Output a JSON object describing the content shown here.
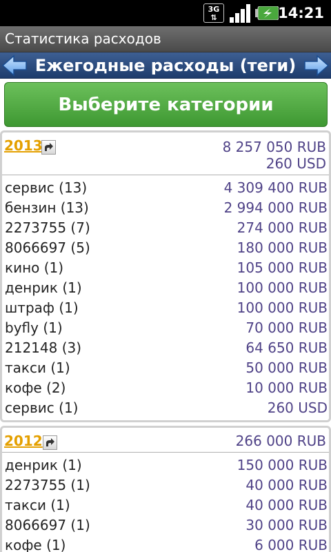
{
  "status_bar": {
    "network_label": "3G",
    "time": "14:21",
    "icons": [
      "3g-icon",
      "signal-icon",
      "battery-icon"
    ]
  },
  "app": {
    "title": "Статистика расходов"
  },
  "nav": {
    "title": "Ежегодные расходы (теги)",
    "prev_icon": "arrow-left-icon",
    "next_icon": "arrow-right-icon"
  },
  "category_button": {
    "label": "Выберите категории"
  },
  "colors": {
    "year_link": "#e4a000",
    "amount": "#4f4287",
    "button_green": "#4caf3f",
    "nav_blue": "#2a4b7e"
  },
  "sections": [
    {
      "year": "2013",
      "totals": [
        "8 257 050 RUB",
        "260 USD"
      ],
      "rows": [
        {
          "label": "сервис (13)",
          "value": "4 309 400 RUB"
        },
        {
          "label": "бензин (13)",
          "value": "2 994 000 RUB"
        },
        {
          "label": "2273755 (7)",
          "value": "274 000 RUB"
        },
        {
          "label": "8066697 (5)",
          "value": "180 000 RUB"
        },
        {
          "label": "кино (1)",
          "value": "105 000 RUB"
        },
        {
          "label": "денрик (1)",
          "value": "100 000 RUB"
        },
        {
          "label": "штраф (1)",
          "value": "100 000 RUB"
        },
        {
          "label": "byfly (1)",
          "value": "70 000 RUB"
        },
        {
          "label": "212148 (3)",
          "value": "64 650 RUB"
        },
        {
          "label": "такси (1)",
          "value": "50 000 RUB"
        },
        {
          "label": "кофе (2)",
          "value": "10 000 RUB"
        },
        {
          "label": "сервис (1)",
          "value": "260 USD"
        }
      ]
    },
    {
      "year": "2012",
      "totals": [
        "266 000 RUB"
      ],
      "rows": [
        {
          "label": "денрик (1)",
          "value": "150 000 RUB"
        },
        {
          "label": "2273755 (1)",
          "value": "40 000 RUB"
        },
        {
          "label": "такси (1)",
          "value": "40 000 RUB"
        },
        {
          "label": "8066697 (1)",
          "value": "30 000 RUB"
        },
        {
          "label": "кофе (1)",
          "value": "6 000 RUB"
        }
      ]
    }
  ]
}
